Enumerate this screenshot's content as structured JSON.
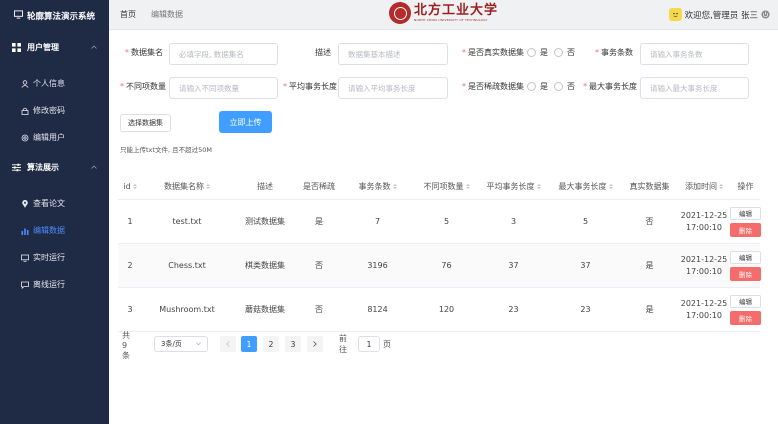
{
  "sidebar": {
    "title": "轮廓算法演示系统",
    "groups": [
      {
        "label": "用户管理",
        "items": [
          "个人信息",
          "修改密码",
          "编辑用户"
        ]
      },
      {
        "label": "算法展示",
        "items": [
          "查看论文",
          "编辑数据",
          "实时运行",
          "离线运行"
        ]
      }
    ],
    "active_item": "编辑数据"
  },
  "header": {
    "breadcrumb": [
      "首页",
      "编辑数据"
    ],
    "logo_name": "北方工业大学",
    "logo_sub": "NORTH CHINA UNIVERSITY OF TECHNOLOGY",
    "user_text": "欢迎您,管理员 张三"
  },
  "form": {
    "dataset_name_label": "数据集名",
    "dataset_name_placeholder": "必填字段, 数据集名",
    "desc_label": "描述",
    "desc_placeholder": "数据集基本描述",
    "is_real_label": "是否真实数据集",
    "yes": "是",
    "no": "否",
    "tx_count_label": "事务条数",
    "tx_count_placeholder": "请输入事务条数",
    "distinct_label": "不同项数量",
    "distinct_placeholder": "请输入不同项数量",
    "avg_len_label": "平均事务长度",
    "avg_len_placeholder": "请输入平均事务长度",
    "is_sparse_label": "是否稀疏数据集",
    "max_len_label": "最大事务长度",
    "max_len_placeholder": "请输入最大事务长度",
    "select_button": "选择数据集",
    "upload_button": "立即上传",
    "hint": "只能上传txt文件, 且不超过50M"
  },
  "table": {
    "headers": [
      "id",
      "数据集名称",
      "描述",
      "是否稀疏",
      "事务条数",
      "不同项数量",
      "平均事务长度",
      "最大事务长度",
      "真实数据集",
      "添加时间",
      "操作"
    ],
    "rows": [
      {
        "id": "1",
        "name": "test.txt",
        "desc": "测试数据集",
        "sparse": "是",
        "tx": "7",
        "distinct": "5",
        "avg": "3",
        "max": "5",
        "real": "否",
        "date": "2021-12-25",
        "time": "17:00:10"
      },
      {
        "id": "2",
        "name": "Chess.txt",
        "desc": "棋类数据集",
        "sparse": "否",
        "tx": "3196",
        "distinct": "76",
        "avg": "37",
        "max": "37",
        "real": "是",
        "date": "2021-12-25",
        "time": "17:00:10"
      },
      {
        "id": "3",
        "name": "Mushroom.txt",
        "desc": "蘑菇数据集",
        "sparse": "否",
        "tx": "8124",
        "distinct": "120",
        "avg": "23",
        "max": "23",
        "real": "是",
        "date": "2021-12-25",
        "time": "17:00:10"
      }
    ],
    "edit_label": "编辑",
    "delete_label": "删除"
  },
  "pagination": {
    "total": "共 9 条",
    "page_size": "3条/页",
    "pages": [
      "1",
      "2",
      "3"
    ],
    "current": "1",
    "goto_label": "前往",
    "goto_value": "1",
    "page_unit": "页"
  },
  "colors": {
    "sidebar_bg": "#1f2a44",
    "primary": "#409eff",
    "danger": "#f56c6c",
    "required": "#f56c6c"
  }
}
